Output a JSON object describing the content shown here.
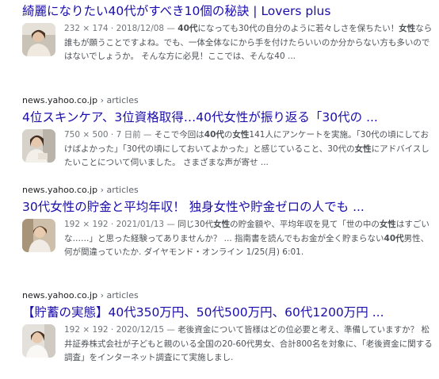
{
  "results": [
    {
      "title": "綺麗になりたい40代がすべき10個の秘訣 | Lovers plus",
      "meta": "232 × 174 · 2018/12/08 —",
      "snippet": [
        {
          "t": " "
        },
        {
          "t": "40代",
          "b": true
        },
        {
          "t": "になっても30代の自分のように若々しさを保ちたい！"
        },
        {
          "t": "女性",
          "b": true
        },
        {
          "t": "なら誰もが願うことですよね。でも、一体全体なにから手を付けたらいいのか分からない方も多いのではないでしょうか。 そんな方に必見！ここでは、そんな40 ..."
        }
      ]
    },
    {
      "source": "news.yahoo.co.jp",
      "path": "articles",
      "title": "4位スキンケア、3位資格取得…40代女性が振り返る「30代の ...",
      "meta": "750 × 500 · 7 日前 —",
      "snippet": [
        {
          "t": " そこで今回は"
        },
        {
          "t": "40代",
          "b": true
        },
        {
          "t": "の"
        },
        {
          "t": "女性",
          "b": true
        },
        {
          "t": "141人にアンケートを実施。「30代の頃にしておけばよかった」「30代の頃にしておいてよかった」と感じていること、30代の"
        },
        {
          "t": "女性",
          "b": true
        },
        {
          "t": "にアドバイスしたいことについて伺いました。 さまざまな声が寄せ ..."
        }
      ]
    },
    {
      "source": "news.yahoo.co.jp",
      "path": "articles",
      "title": "30代女性の貯金と平均年収！ 独身女性や貯金ゼロの人でも ...",
      "meta": "192 × 192 · 2021/01/13 —",
      "snippet": [
        {
          "t": " 同じ30代"
        },
        {
          "t": "女性",
          "b": true
        },
        {
          "t": "の貯金額や、平均年収を見て「世の中の"
        },
        {
          "t": "女性",
          "b": true
        },
        {
          "t": "はすごいな……」と思った経験ってありませんか？ ... 指南書を読んでもお金が全く貯まらない"
        },
        {
          "t": "40代",
          "b": true
        },
        {
          "t": "男性、何が間違っていたか. ダイヤモンド・オンライン 1/25(月) 6:01."
        }
      ]
    },
    {
      "source": "news.yahoo.co.jp",
      "path": "articles",
      "title": "【貯蓄の実態】40代350万円、50代500万円、60代1200万円 ...",
      "meta": "192 × 192 · 2020/12/15 —",
      "snippet": [
        {
          "t": " 老後資金について皆様はどの位必要と考え、準備していますか？ 松井証券株式会社が子どもと親のいる全国の20-60代男女、合計800名を対象に、「老後資金に関する調査」をインターネット調査にて実施しまし."
        }
      ]
    }
  ],
  "colors": {
    "title": "#1a0dab",
    "snippet": "#4d5156",
    "meta": "#70757a"
  }
}
